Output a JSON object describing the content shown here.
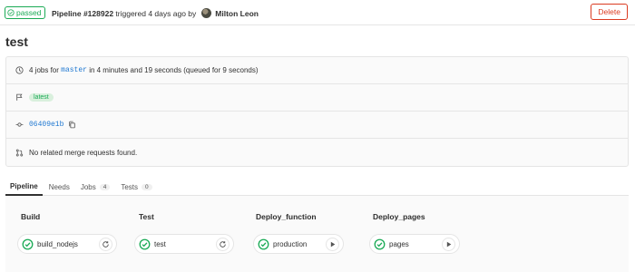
{
  "header": {
    "status": "passed",
    "pipeline_label": "Pipeline #128922",
    "triggered_text": "triggered 4 days ago by",
    "user_name": "Milton Leon",
    "delete_label": "Delete"
  },
  "page_title": "test",
  "info": {
    "jobs_prefix": "4 jobs for",
    "branch": "master",
    "jobs_suffix": "in 4 minutes and 19 seconds (queued for 9 seconds)",
    "tag": "latest",
    "commit_sha": "06409e1b",
    "merge_requests": "No related merge requests found."
  },
  "tabs": [
    {
      "label": "Pipeline",
      "count": null,
      "active": true
    },
    {
      "label": "Needs",
      "count": null,
      "active": false
    },
    {
      "label": "Jobs",
      "count": "4",
      "active": false
    },
    {
      "label": "Tests",
      "count": "0",
      "active": false
    }
  ],
  "stages": [
    {
      "title": "Build",
      "job": "build_nodejs",
      "action": "retry-icon"
    },
    {
      "title": "Test",
      "job": "test",
      "action": "retry-icon"
    },
    {
      "title": "Deploy_function",
      "job": "production",
      "action": "play-icon"
    },
    {
      "title": "Deploy_pages",
      "job": "pages",
      "action": "play-icon"
    }
  ],
  "colors": {
    "success": "#1aaa55",
    "danger": "#db3b21",
    "link": "#1f78d1"
  }
}
